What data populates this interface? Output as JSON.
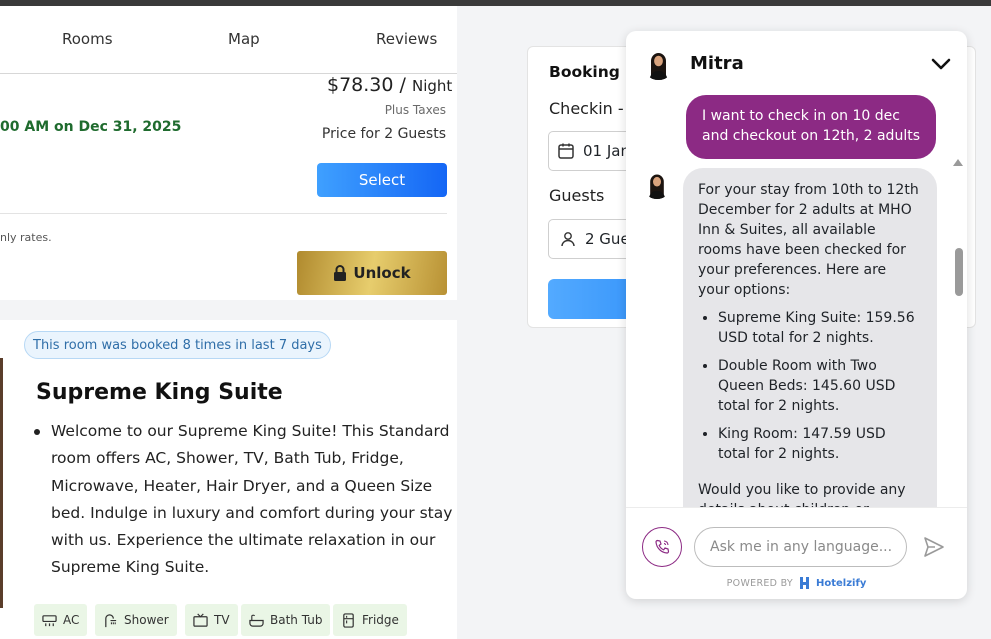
{
  "nav": {
    "rooms": "Rooms",
    "map": "Map",
    "reviews": "Reviews"
  },
  "offer": {
    "price": "$78.30",
    "per": "/",
    "unit": "Night",
    "taxes": "Plus Taxes",
    "guests_price": "Price for 2 Guests",
    "date_text": "00 AM on Dec 31, 2025",
    "select_label": "Select",
    "rates_text": "nly rates.",
    "unlock_label": "Unlock"
  },
  "room": {
    "badge": "This room was booked 8 times in last 7 days",
    "title": "Supreme King Suite",
    "description": "Welcome to our Supreme King Suite! This Standard room offers AC, Shower, TV, Bath Tub, Fridge, Microwave, Heater, Hair Dryer, and a Queen Size bed. Indulge in luxury and comfort during your stay with us. Experience the ultimate relaxation in our Supreme King Suite.",
    "amenities": [
      "AC",
      "Shower",
      "TV",
      "Bath Tub",
      "Fridge"
    ]
  },
  "booking": {
    "title": "Booking S",
    "checkin_label": "Checkin - (",
    "date_value": "01 Jan",
    "guests_label": "Guests",
    "guests_value": "2 Gue"
  },
  "chat": {
    "agent_name": "Mitra",
    "user_message": "I want to check in on 10 dec and checkout on 12th, 2 adults",
    "bot_intro": "For your stay from 10th to 12th December for 2 adults at MHO Inn & Suites, all available rooms have been checked for your preferences. Here are your options:",
    "bot_options": [
      "Supreme King Suite: 159.56 USD total for 2 nights.",
      "Double Room with Two Queen Beds: 145.60 USD total for 2 nights.",
      "King Room: 147.59 USD total for 2 nights."
    ],
    "bot_outro": "Would you like to provide any details about children or infants if",
    "input_placeholder": "Ask me in any language...",
    "powered_by": "POWERED BY",
    "brand": "Hotelzify"
  },
  "colors": {
    "accent_purple": "#8c2a84",
    "select_blue": "#1466f5",
    "gold": "#d4b356",
    "date_green": "#1f6b2e"
  }
}
